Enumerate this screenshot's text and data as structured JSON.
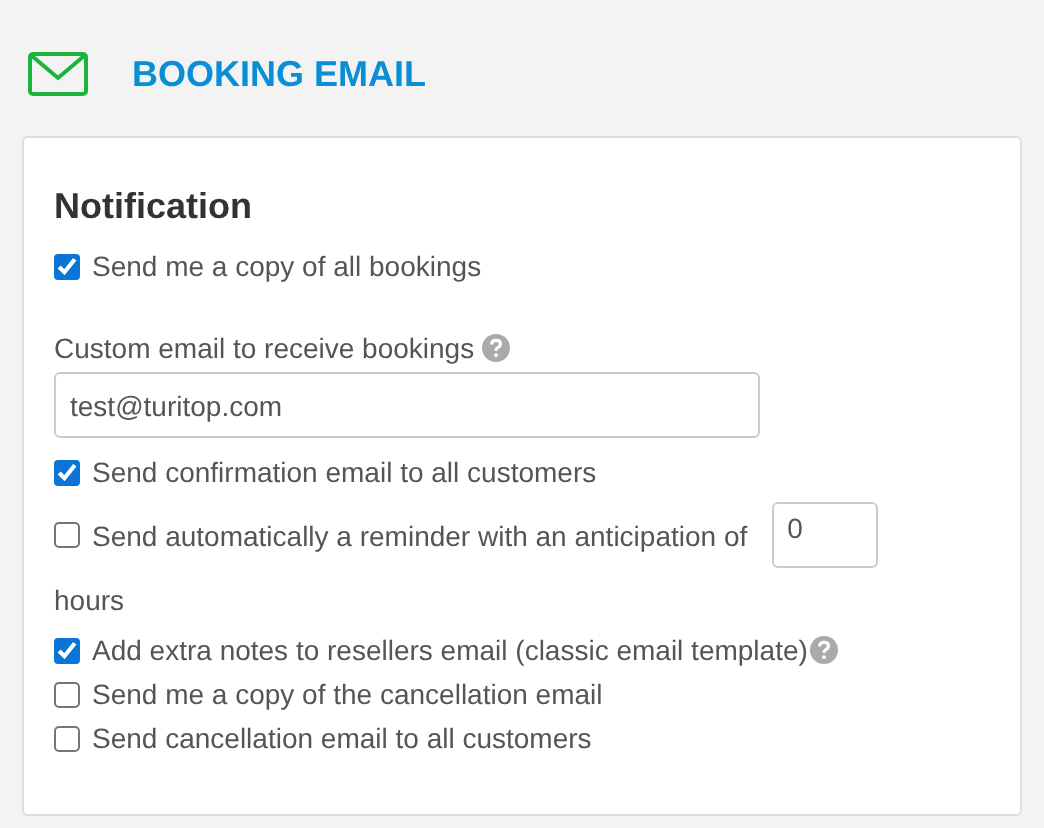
{
  "header": {
    "title": "BOOKING EMAIL"
  },
  "section": {
    "title": "Notification",
    "options_top": [
      {
        "kind": "checkbox",
        "label": "Send me a copy of all bookings",
        "checked": true
      }
    ],
    "custom_email": {
      "label": "Custom email to receive bookings",
      "help": true,
      "value": "test@turitop.com"
    },
    "options": [
      {
        "kind": "checkbox",
        "label": "Send confirmation email to all customers",
        "checked": true
      },
      {
        "kind": "reminder",
        "label": "Send automatically a reminder with an anticipation of",
        "checked": false,
        "value": "0",
        "suffix": "hours"
      },
      {
        "kind": "checkbox",
        "label": "Add extra notes to resellers email (classic email template)",
        "checked": true,
        "help": true
      },
      {
        "kind": "checkbox",
        "label": "Send me a copy of the cancellation email",
        "checked": false
      },
      {
        "kind": "checkbox",
        "label": "Send cancellation email to all customers",
        "checked": false
      }
    ]
  }
}
